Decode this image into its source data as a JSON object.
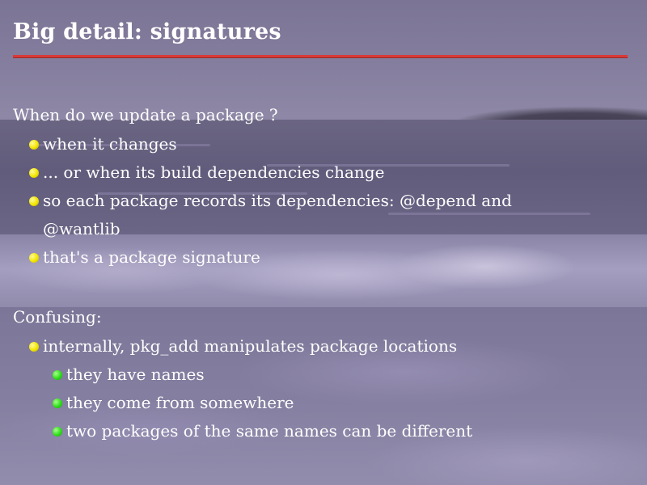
{
  "slide": {
    "title": "Big detail: signatures",
    "section1": {
      "heading": "When do we update a package ?",
      "items": [
        "when it changes",
        "... or when its build dependencies change",
        "so each package records its dependencies: @depend and",
        "@wantlib",
        "that's a package signature"
      ]
    },
    "section2": {
      "heading": "Confusing:",
      "items": [
        "internally, pkg_add manipulates package locations"
      ],
      "subitems": [
        "they have names",
        "they come from somewhere",
        "two packages of the same names can be different"
      ]
    }
  },
  "colors": {
    "title_rule": "#d93a3a",
    "bullet_level1": "#f2e600",
    "bullet_level2": "#2ede18",
    "text": "#ffffff"
  },
  "icons": {
    "level1_bullet": "yellow-dot-icon",
    "level2_bullet": "green-dot-icon"
  }
}
